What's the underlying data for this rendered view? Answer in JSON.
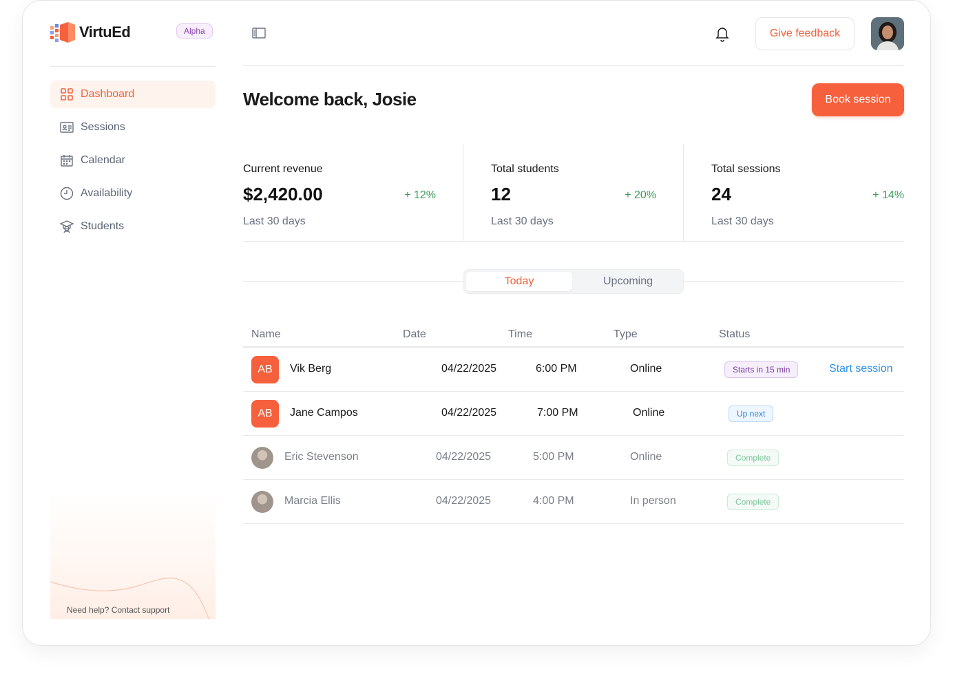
{
  "brand": {
    "name": "VirtuEd",
    "badge": "Alpha",
    "accent": "#f7603d"
  },
  "sidebar": {
    "items": [
      {
        "label": "Dashboard",
        "icon": "grid-icon",
        "active": true
      },
      {
        "label": "Sessions",
        "icon": "id-card-icon",
        "active": false
      },
      {
        "label": "Calendar",
        "icon": "calendar-icon",
        "active": false
      },
      {
        "label": "Availability",
        "icon": "clock-icon",
        "active": false
      },
      {
        "label": "Students",
        "icon": "graduation-cap-icon",
        "active": false
      }
    ],
    "help_text": "Need help? Contact support"
  },
  "header": {
    "feedback_label": "Give feedback",
    "welcome": "Welcome back, Josie",
    "book_label": "Book session"
  },
  "stats": [
    {
      "label": "Current revenue",
      "value": "$2,420.00",
      "delta": "+ 12%",
      "period": "Last 30 days"
    },
    {
      "label": "Total students",
      "value": "12",
      "delta": "+ 20%",
      "period": "Last 30 days"
    },
    {
      "label": "Total sessions",
      "value": "24",
      "delta": "+ 14%",
      "period": "Last 30 days"
    }
  ],
  "tabs": {
    "today": "Today",
    "upcoming": "Upcoming",
    "selected": "Today"
  },
  "table": {
    "columns": {
      "name": "Name",
      "date": "Date",
      "time": "Time",
      "type": "Type",
      "status": "Status"
    },
    "rows": [
      {
        "initials": "AB",
        "name": "Vik Berg",
        "date": "04/22/2025",
        "time": "6:00 PM",
        "type": "Online",
        "status": "Starts in 15 min",
        "action": "Start session"
      },
      {
        "initials": "AB",
        "name": "Jane Campos",
        "date": "04/22/2025",
        "time": "7:00 PM",
        "type": "Online",
        "status": "Up next"
      },
      {
        "name": "Eric Stevenson",
        "date": "04/22/2025",
        "time": "5:00 PM",
        "type": "Online",
        "status": "Complete"
      },
      {
        "name": "Marcia Ellis",
        "date": "04/22/2025",
        "time": "4:00 PM",
        "type": "In person",
        "status": "Complete"
      }
    ]
  }
}
